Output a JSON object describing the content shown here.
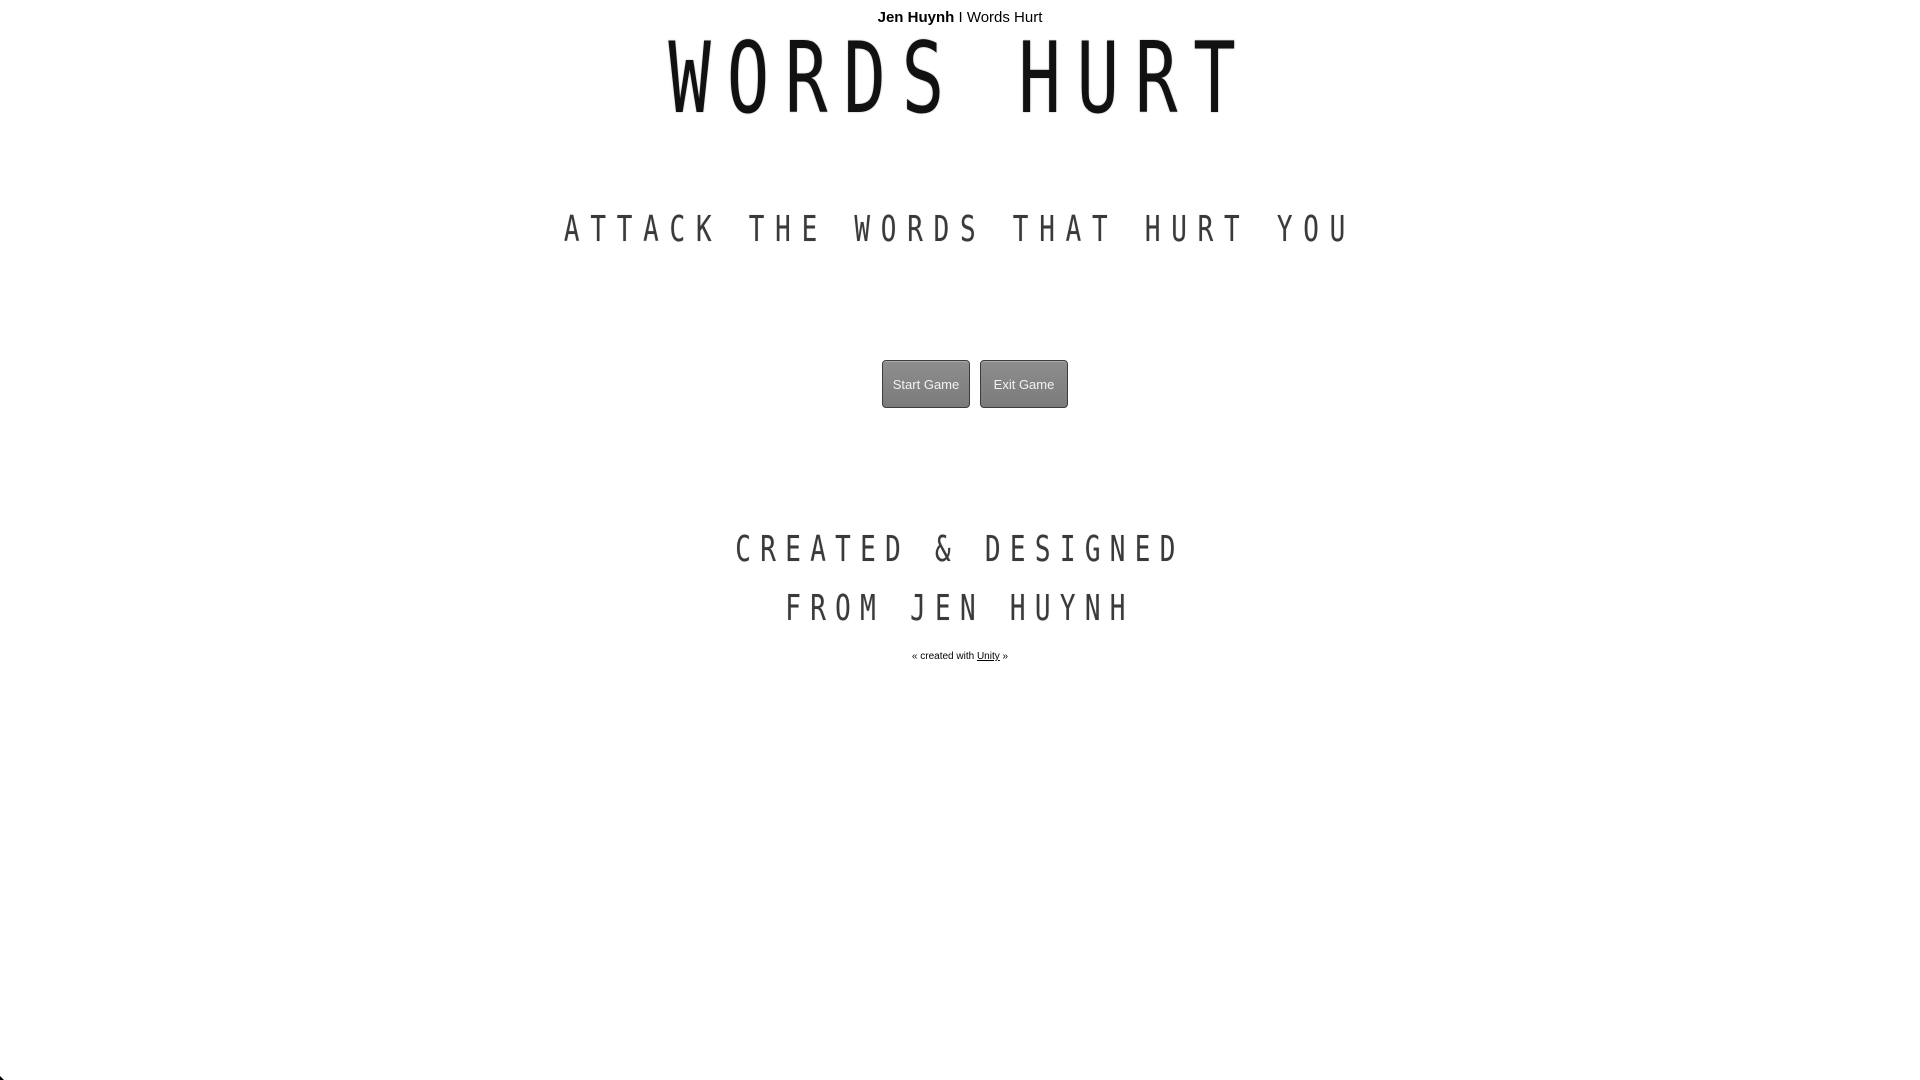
{
  "header": {
    "author": "Jen Huynh",
    "separator": "I",
    "game_title": "Words Hurt"
  },
  "game": {
    "title": "WORDS HURT",
    "subtitle": "ATTACK THE WORDS THAT HURT YOU",
    "buttons": {
      "start_label": "Start Game",
      "exit_label": "Exit Game"
    },
    "credits": {
      "line1": "CREATED & DESIGNED",
      "line2": "FROM JEN HUYNH"
    }
  },
  "footer": {
    "prefix": "« created with",
    "link_text": "Unity",
    "suffix": "»"
  },
  "colors": {
    "background": "#ffffff",
    "button_fill": "#838383",
    "button_text": "#f2f2f2",
    "title_text": "#111111"
  }
}
